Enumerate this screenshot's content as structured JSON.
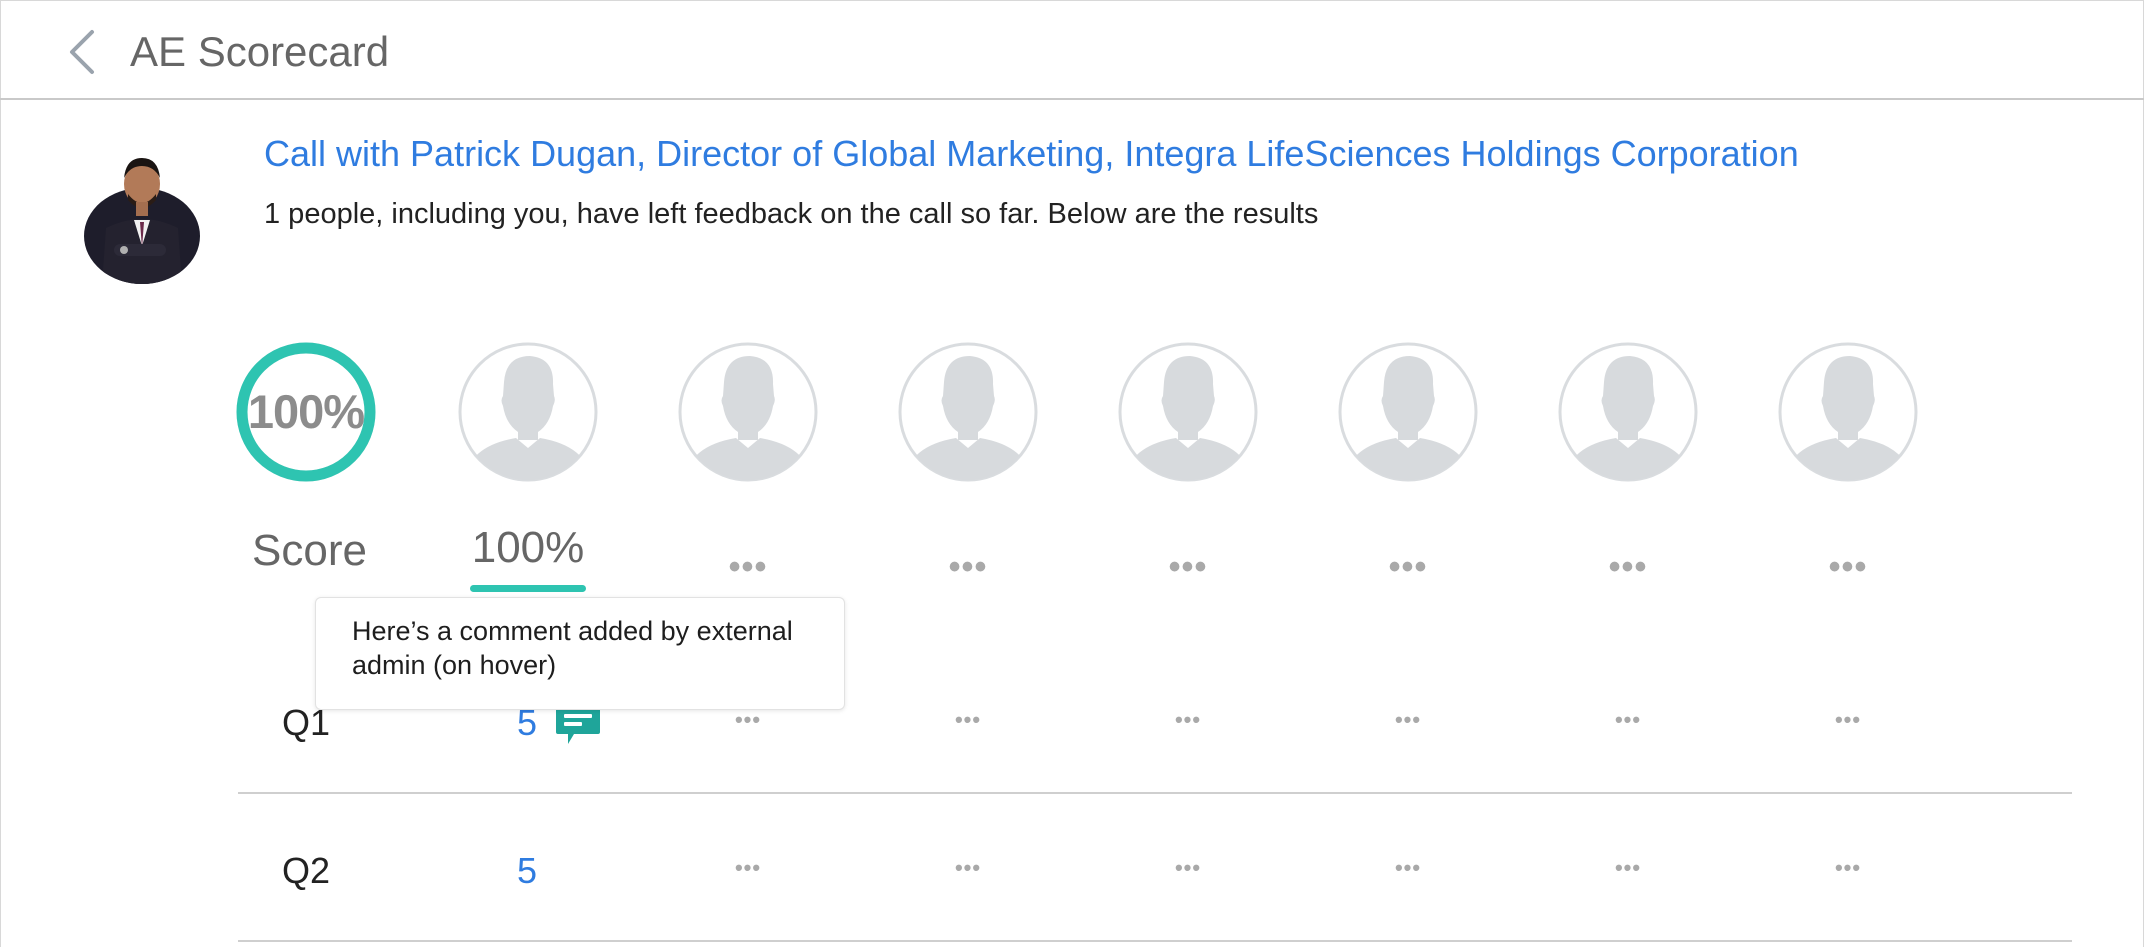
{
  "header": {
    "title": "AE Scorecard",
    "back_icon": "chevron-left-icon"
  },
  "call": {
    "title": "Call with Patrick Dugan, Director of Global Marketing, Integra LifeSciences Holdings Corporation",
    "subtitle": "1 people, including you, have left feedback on the call so far. Below are the results"
  },
  "summary": {
    "score_label": "Score",
    "overall_score_text": "100%",
    "overall_score": 100
  },
  "reviewers": [
    {
      "score": "100%"
    },
    {
      "score": "•••"
    },
    {
      "score": "•••"
    },
    {
      "score": "•••"
    },
    {
      "score": "•••"
    },
    {
      "score": "•••"
    },
    {
      "score": "•••"
    }
  ],
  "tooltip": {
    "text": "Here’s a comment added by external admin (on hover)"
  },
  "questions": [
    {
      "label": "Q1",
      "values": [
        "5",
        "•••",
        "•••",
        "•••",
        "•••",
        "•••",
        "•••"
      ],
      "has_comment": true
    },
    {
      "label": "Q2",
      "values": [
        "5",
        "•••",
        "•••",
        "•••",
        "•••",
        "•••",
        "•••"
      ],
      "has_comment": false
    }
  ],
  "colors": {
    "accent": "#2ec4b1",
    "link": "#2f7ce0",
    "placeholder": "#d7dadd",
    "comment": "#1fa59a"
  }
}
